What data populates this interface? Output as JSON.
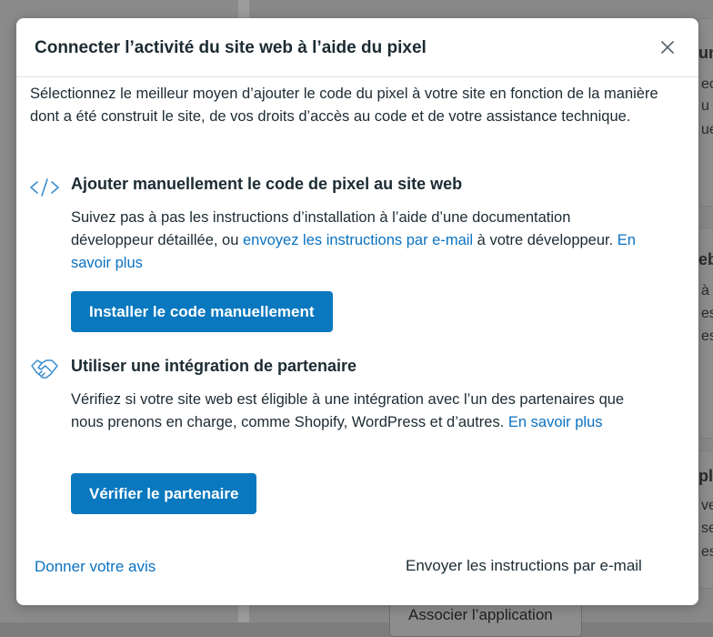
{
  "background": {
    "snippets": [
      "un",
      "ec",
      "u",
      "ue",
      "eb",
      "à",
      "es",
      "es",
      "pl",
      "ve",
      "se",
      "es"
    ],
    "button_label": "Associer l’application"
  },
  "modal": {
    "title": "Connecter l’activité du site web à l’aide du pixel",
    "intro": "Sélectionnez le meilleur moyen d’ajouter le code du pixel à votre site en fonction de la manière dont a été construit le site, de vos droits d’accès au code et de votre assistance technique.",
    "manual": {
      "icon": "code-icon",
      "title": "Ajouter manuellement le code de pixel au site web",
      "text_before": "Suivez pas à pas les instructions d’installation à l’aide d’une documentation développeur détaillée, ou ",
      "link_email": "envoyez les instructions par e-mail",
      "text_after": " à votre développeur. ",
      "link_learn": "En savoir plus",
      "button": "Installer le code manuellement"
    },
    "partner": {
      "icon": "handshake-icon",
      "title": "Utiliser une intégration de partenaire",
      "text": "Vérifiez si votre site web est éligible à une intégration avec l’un des partenaires que nous prenons en charge, comme Shopify, WordPress et d’autres. ",
      "link_learn": "En savoir plus",
      "button": "Vérifier le partenaire"
    },
    "footer": {
      "feedback_link": "Donner votre avis",
      "email_button": "Envoyer les instructions par e-mail"
    }
  },
  "colors": {
    "accent": "#0a78be",
    "link": "#0a72c2",
    "text": "#1c2b33",
    "overlay": "#8a8a8a"
  }
}
